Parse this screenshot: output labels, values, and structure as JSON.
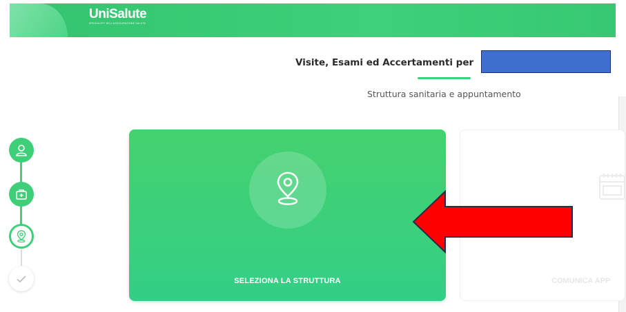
{
  "header": {
    "logo_name": "UniSalute",
    "logo_tagline": "SPECIALISTI NELL'ASSICURAZIONE SALUTE",
    "color": "#3ecf78"
  },
  "page": {
    "title": "Visite, Esami ed Accertamenti per",
    "subtitle": "Struttura sanitaria e appuntamento"
  },
  "stepper": {
    "steps": [
      {
        "icon": "user-icon",
        "state": "done"
      },
      {
        "icon": "medical-kit-icon",
        "state": "done"
      },
      {
        "icon": "location-pin-icon",
        "state": "active"
      },
      {
        "icon": "check-icon",
        "state": "todo"
      }
    ]
  },
  "cards": {
    "select_structure": {
      "label": "SELEZIONA LA STRUTTURA",
      "icon": "location-pin-icon"
    },
    "communicate": {
      "label": "COMUNICA APP",
      "icon": "calendar-icon"
    }
  },
  "annotation": {
    "arrow_color": "#ff0000"
  }
}
